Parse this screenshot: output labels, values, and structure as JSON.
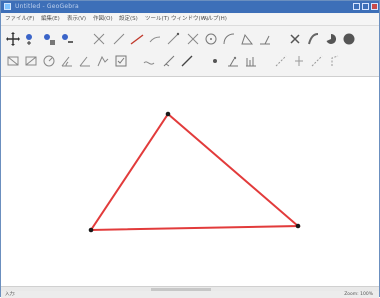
{
  "window": {
    "title": "Untitled - GeoGebra"
  },
  "menubar": {
    "items": [
      "ファイル(F)",
      "編集(E)",
      "表示(V)",
      "作図(O)",
      "設定(S)",
      "ツール(T)",
      "ウィンドウ(W)",
      "ヘルプ(H)"
    ]
  },
  "toolbar": {
    "row1": [
      "move-icon",
      "point-icon",
      "point-on-object-icon",
      "point-label-icon",
      "line-icon",
      "segment-icon",
      "ray-icon",
      "vector-icon",
      "polyline-icon",
      "perpendicular-icon",
      "circle-icon",
      "arc-icon",
      "angle-icon",
      "reflect-icon",
      "slider-icon",
      "conic-icon",
      "pie-icon",
      "filled-circle-icon"
    ],
    "row2": [
      "relation-icon",
      "text-icon",
      "sequence-icon",
      "transform-icon",
      "locus-icon",
      "image-icon",
      "checkbox-icon",
      "function-icon",
      "line-tool-icon",
      "point-tool-icon",
      "angle-tool-icon",
      "measure-icon",
      "tangent-icon",
      "graph-icon",
      "move-view-icon",
      "zoom-icon"
    ]
  },
  "canvas": {
    "triangle": {
      "stroke_color": "#e23b3b",
      "vertex_color": "#1a1a1a"
    }
  },
  "statusbar": {
    "left": "入力:",
    "right": "Zoom: 100%"
  }
}
